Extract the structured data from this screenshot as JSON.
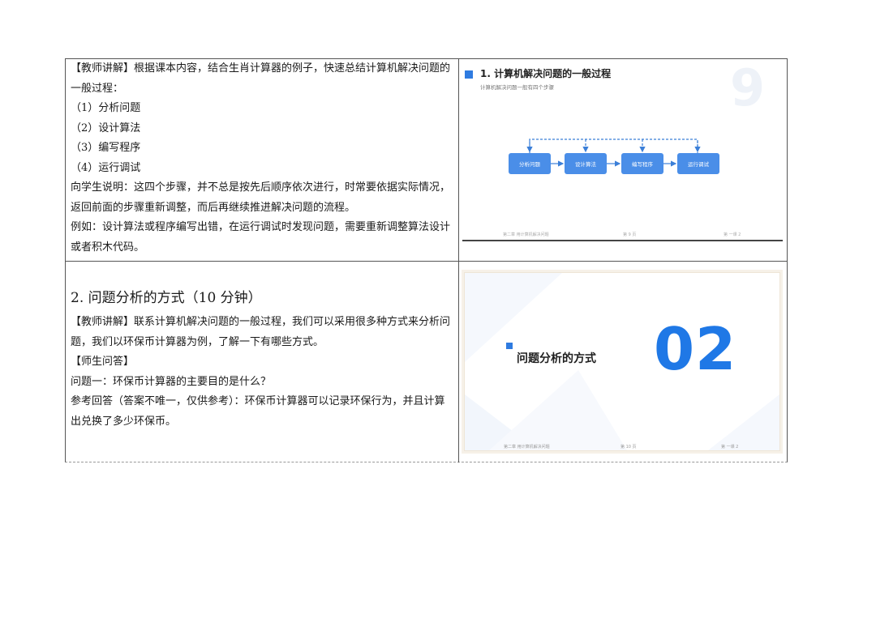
{
  "row1": {
    "paragraphs": [
      "【教师讲解】根据课本内容，结合生肖计算器的例子，快速总结计算机解决问题的一般过程：",
      "（1）分析问题",
      "（2）设计算法",
      "（3）编写程序",
      "（4）运行调试",
      "向学生说明：这四个步骤，并不总是按先后顺序依次进行，时常要依据实际情况，返回前面的步骤重新调整，而后再继续推进解决问题的流程。",
      "例如：设计算法或程序编写出错，在运行调试时发现问题，需要重新调整算法设计或者积木代码。"
    ]
  },
  "slide1": {
    "title": "1. 计算机解决问题的一般过程",
    "subtitle": "计算机解决问题一般有四个步骤",
    "big_number": "9",
    "steps": [
      "分析问题",
      "设计算法",
      "编写程序",
      "运行调试"
    ],
    "footer_left": "第二章 用计算机解决问题",
    "footer_mid": "第 9 页",
    "footer_right": "第 一课 2"
  },
  "row2": {
    "heading": "2.  问题分析的方式（10 分钟）",
    "paragraphs": [
      "【教师讲解】联系计算机解决问题的一般过程，我们可以采用很多种方式来分析问题，我们以环保币计算器为例，了解一下有哪些方式。",
      "【师生问答】",
      "问题一：环保币计算器的主要目的是什么？",
      "参考回答（答案不唯一，仅供参考）：环保币计算器可以记录环保行为，并且计算出兑换了多少环保币。"
    ]
  },
  "slide2": {
    "title": "问题分析的方式",
    "big_number": "02",
    "footer_left": "第二章 用计算机解决问题",
    "footer_mid": "第 10 页",
    "footer_right": "第 一课 2"
  },
  "colors": {
    "accent_blue": "#2f7be0",
    "step_box_blue": "#4a8ee8",
    "big_number_blue": "#1f78e6"
  }
}
